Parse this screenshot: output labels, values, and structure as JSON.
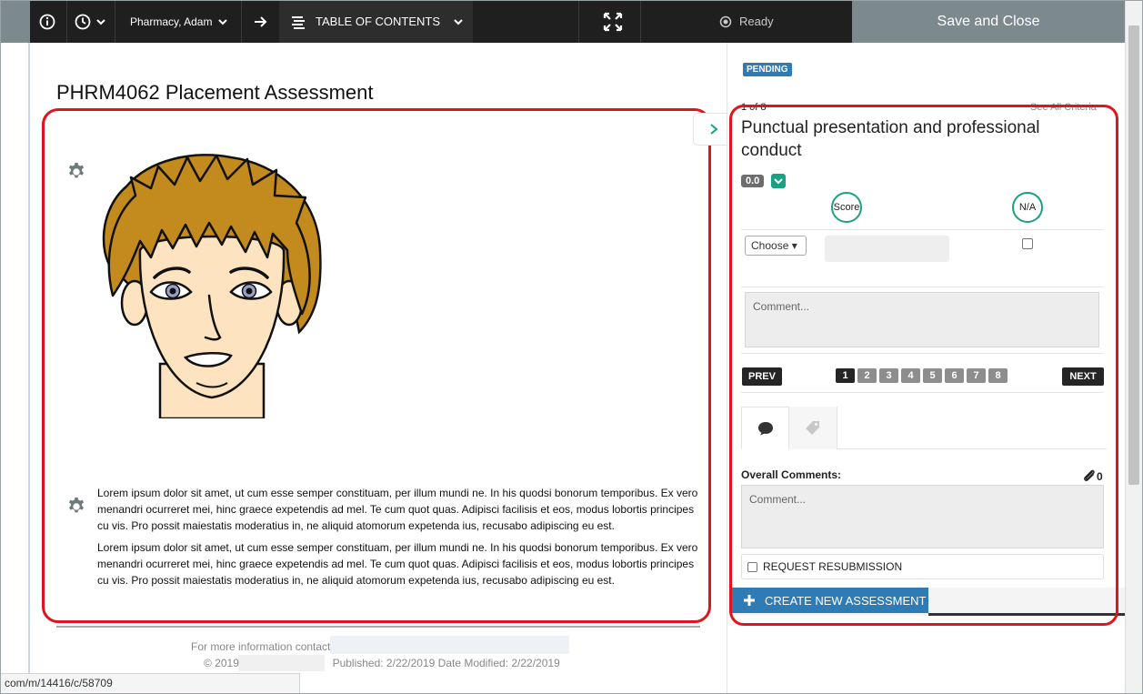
{
  "topbar": {
    "user_name": "Pharmacy, Adam",
    "toc_label": "TABLE OF CONTENTS",
    "status": "Ready",
    "save_close": "Save and Close"
  },
  "page": {
    "title": "PHRM4062 Placement Assessment",
    "paragraphs": [
      "Lorem ipsum dolor sit amet, ut cum esse semper constituam, per illum mundi ne. In his quodsi bonorum temporibus. Ex vero menandri ocurreret mei, hinc graece expetendis ad mel. Te cum quot quas. Adipisci facilisis et eos, modus lobortis principes cu vis. Pro possit maiestatis moderatius in, ne aliquid atomorum expetenda ius, recusabo adipiscing eu est.",
      "Lorem ipsum dolor sit amet, ut cum esse semper constituam, per illum mundi ne. In his quodsi bonorum temporibus. Ex vero menandri ocurreret mei, hinc graece expetendis ad mel. Te cum quot quas. Adipisci facilisis et eos, modus lobortis principes cu vis. Pro possit maiestatis moderatius in, ne aliquid atomorum expetenda ius, recusabo adipiscing eu est."
    ],
    "footer_contact": "For more information contact",
    "footer_copyright": "© 2019",
    "footer_published": "Published: 2/22/2019 Date Modified: 2/22/2019",
    "status_url": "com/m/14416/c/58709"
  },
  "panel": {
    "badge": "PENDING",
    "counter": "1 of 8",
    "see_all": "See All Criteria",
    "criteria_title": "Punctual presentation and professional conduct",
    "score_value": "0.0",
    "col_score": "Score",
    "col_na": "N/A",
    "choose_label": "Choose ▾",
    "comment_placeholder": "Comment...",
    "prev": "PREV",
    "next": "NEXT",
    "pages": [
      "1",
      "2",
      "3",
      "4",
      "5",
      "6",
      "7",
      "8"
    ],
    "active_page": "1",
    "overall_comments": "Overall Comments:",
    "attachments": "0",
    "overall_placeholder": "Comment...",
    "request_resubmission": "REQUEST RESUBMISSION",
    "create_new": "CREATE NEW ASSESSMENT"
  },
  "icons": {
    "info": "info-icon",
    "history": "clock-icon",
    "arrow": "arrow-right-icon",
    "toc": "list-icon",
    "fullscreen": "expand-icon",
    "status": "radio-dot-icon",
    "settings": "gear-icon",
    "comment_tab": "speech-bubble-icon",
    "tag_tab": "tag-icon",
    "attach": "paperclip-icon",
    "plus": "plus-icon"
  },
  "colors": {
    "topbar": "#1f1f1f",
    "save_button": "#7d8a8d",
    "accent_teal": "#1aa082",
    "primary_blue": "#2e7bb6",
    "highlight_red": "#e0141e"
  }
}
